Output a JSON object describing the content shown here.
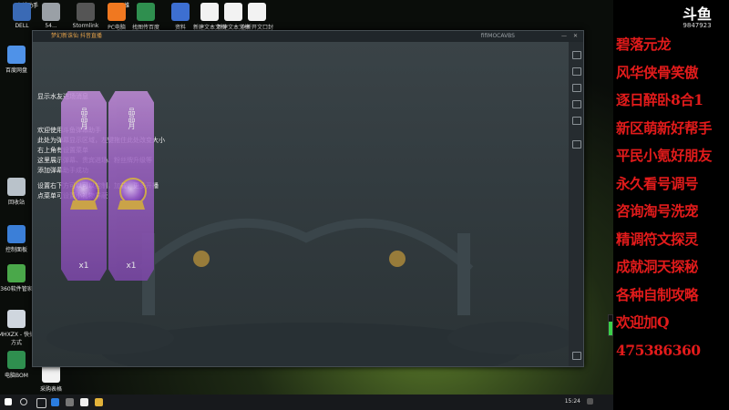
{
  "desktop": {
    "icons_top": [
      {
        "label": "DELL",
        "name": "dell-icon",
        "color": "#3a6ab5"
      },
      {
        "label": "54...",
        "name": "disk-icon",
        "color": "#9aa0a6"
      },
      {
        "label": "Stormlink",
        "name": "stormlink-icon",
        "color": "#555"
      },
      {
        "label": "PC电脑",
        "name": "pc-assist-icon",
        "color": "#f07820"
      },
      {
        "label": "找图传百度",
        "name": "excel-icon",
        "color": "#2f8f4f"
      },
      {
        "label": "资料",
        "name": "doc-icon",
        "color": "#3d6fd1"
      },
      {
        "label": "新建文本文档",
        "name": "text-doc-icon-1",
        "color": "#f2f2f2"
      },
      {
        "label": "新建文本文档",
        "name": "text-doc-icon-2",
        "color": "#f2f2f2"
      },
      {
        "label": "全新开文口封",
        "name": "text-doc-icon-3",
        "color": "#f2f2f2"
      }
    ],
    "icons_left": [
      {
        "label": "百度网盘",
        "name": "baidu-pan-icon",
        "color": "#4f92e8"
      },
      {
        "label": "回收站",
        "name": "recycle-bin-icon",
        "color": "#b9c2ca"
      },
      {
        "label": "控制面板",
        "name": "control-panel-icon",
        "color": "#3b7fd8"
      },
      {
        "label": "360软件管家",
        "name": "360-manager-icon",
        "color": "#4aa84a"
      },
      {
        "label": "MHXZX - 快捷方式",
        "name": "mhxzx-shortcut-icon",
        "color": "#cfd6de"
      },
      {
        "label": "电脑BOM",
        "name": "bom-icon",
        "color": "#2f8f4f"
      },
      {
        "label": "采购表格",
        "name": "purchase-icon",
        "color": "#f2f2f2"
      }
    ],
    "top_labels": [
      "直播助手",
      "二维"
    ]
  },
  "app": {
    "title": "梦幻新诛仙 抖音直播",
    "user": "fifiMOCAVBS",
    "chat_lines": [
      "显示水友进场消息",
      "欢迎使用斗鱼弹幕助手",
      "此处为弹幕显示区域，左键拖住此处改变大小",
      "右上角有设置菜单",
      "这里展示弹幕、贵宾进场、粉丝牌升级等",
      "添加弹幕助手成功",
      "设置右下方可以可以控制，加载，更多开播",
      "点菜单可设置小礼物屏蔽"
    ],
    "cards": [
      {
        "label": "品品月",
        "qty": "x1"
      },
      {
        "label": "品品月",
        "qty": "x1"
      }
    ]
  },
  "promo": {
    "logo": "斗鱼",
    "room_id": "9847923",
    "lines": [
      "碧落元龙",
      "风华侠骨笑傲",
      "逐日醉卧8合1",
      "新区萌新好帮手",
      "平民小氪好朋友",
      "永久看号调号",
      "咨询淘号洗宠",
      "精调符文探灵",
      "成就洞天探秘",
      "各种自制攻略",
      "欢迎加Q",
      "475386360"
    ]
  },
  "taskbar": {
    "clock": "15:24",
    "apps": [
      "start",
      "search",
      "task-view",
      "edge",
      "settings",
      "douyu",
      "folder"
    ]
  },
  "volume_level": 0.7
}
